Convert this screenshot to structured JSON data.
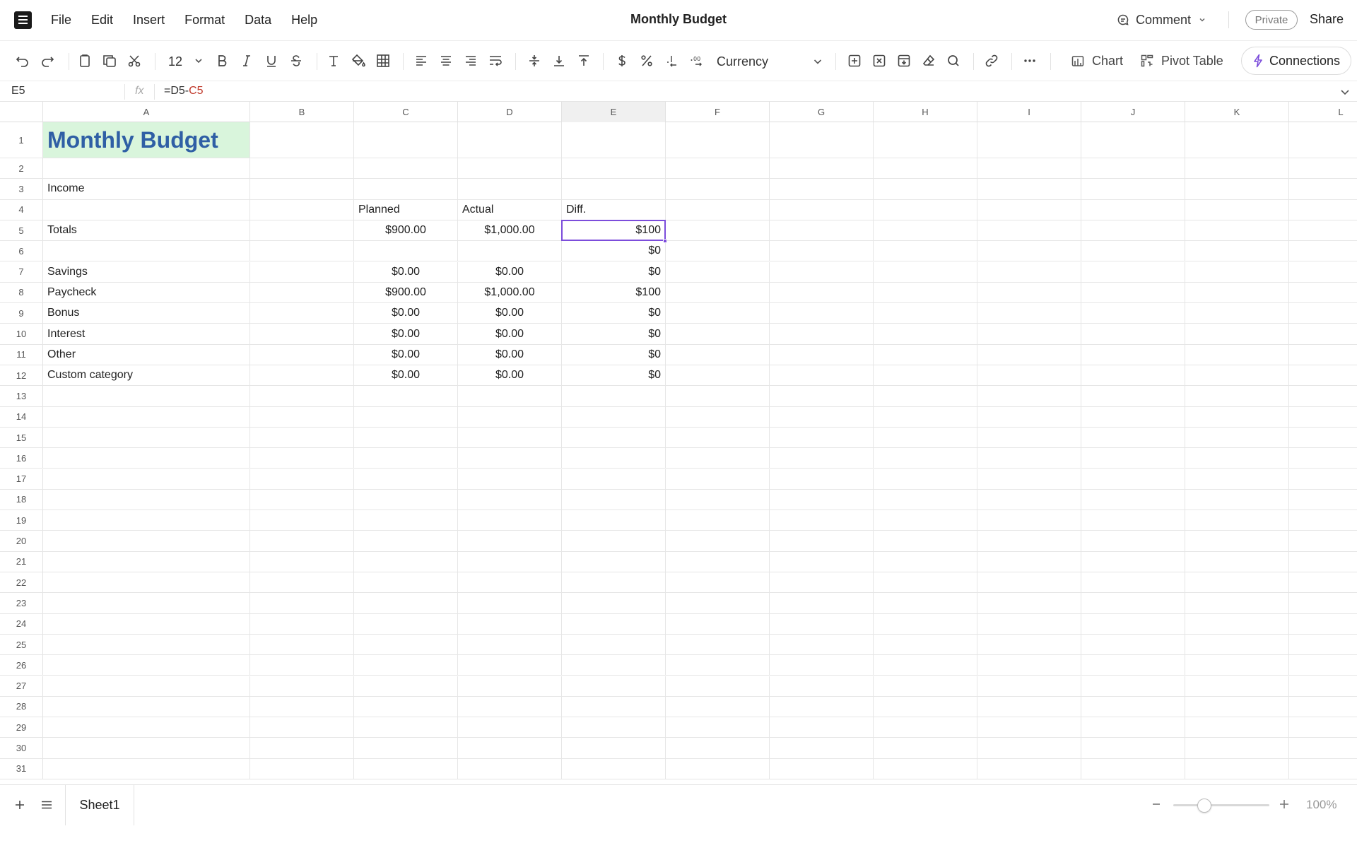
{
  "menu": {
    "items": [
      "File",
      "Edit",
      "Insert",
      "Format",
      "Data",
      "Help"
    ],
    "doc_title": "Monthly Budget",
    "comment_label": "Comment",
    "private_label": "Private",
    "share_label": "Share"
  },
  "toolbar": {
    "font_size": "12",
    "number_format": "Currency",
    "chart_label": "Chart",
    "pivot_label": "Pivot Table",
    "connections_label": "Connections",
    "accent_color": "#7c4ddb"
  },
  "formula_bar": {
    "cell_ref": "E5",
    "fx_label": "fx",
    "formula_part1": "=D5-",
    "formula_part2": "C5"
  },
  "sheet": {
    "columns": [
      "A",
      "B",
      "C",
      "D",
      "E",
      "F",
      "G",
      "H",
      "I",
      "J",
      "K",
      "L"
    ],
    "active_column": "E",
    "active_cell": "E5",
    "row_count": 31,
    "title": "Monthly Budget",
    "title_bg": "#d9f5dc",
    "title_color": "#2f5fa5",
    "section_label": "Income",
    "headers": {
      "planned": "Planned",
      "actual": "Actual",
      "diff": "Diff."
    },
    "totals": {
      "label": "Totals",
      "planned": "$900.00",
      "actual": "$1,000.00",
      "diff": "$100"
    },
    "row6_diff": "$0",
    "items": [
      {
        "label": "Savings",
        "planned": "$0.00",
        "actual": "$0.00",
        "diff": "$0"
      },
      {
        "label": "Paycheck",
        "planned": "$900.00",
        "actual": "$1,000.00",
        "diff": "$100"
      },
      {
        "label": "Bonus",
        "planned": "$0.00",
        "actual": "$0.00",
        "diff": "$0"
      },
      {
        "label": "Interest",
        "planned": "$0.00",
        "actual": "$0.00",
        "diff": "$0"
      },
      {
        "label": "Other",
        "planned": "$0.00",
        "actual": "$0.00",
        "diff": "$0"
      },
      {
        "label": "Custom category",
        "planned": "$0.00",
        "actual": "$0.00",
        "diff": "$0"
      }
    ]
  },
  "footer": {
    "sheet_tab": "Sheet1",
    "zoom": "100%"
  }
}
